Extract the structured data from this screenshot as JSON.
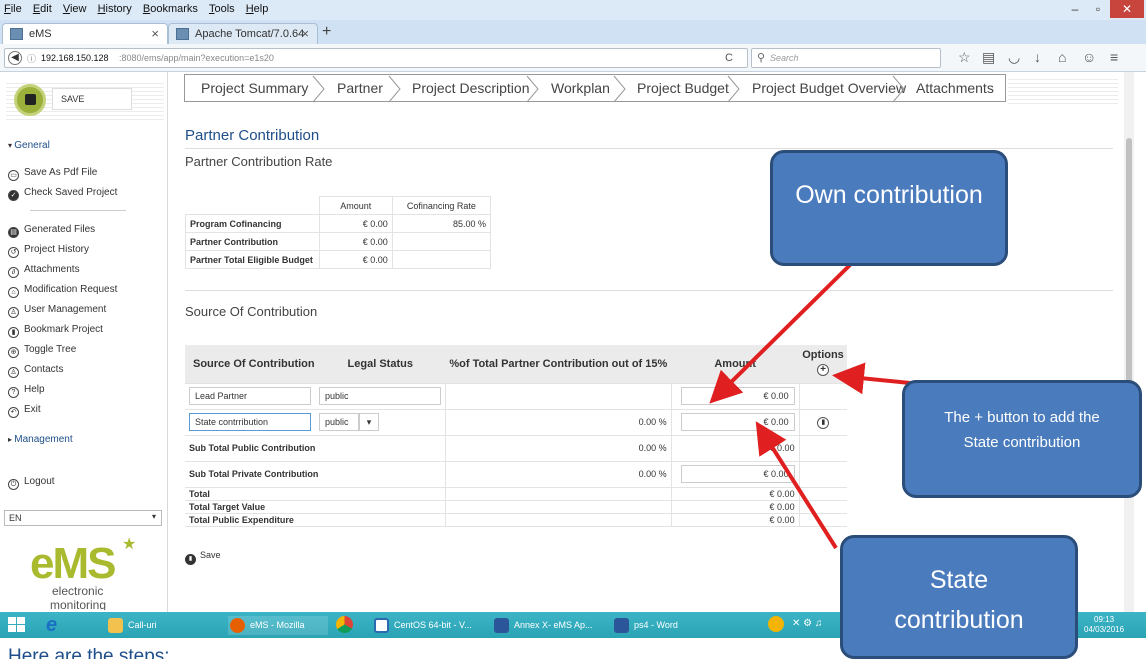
{
  "browser": {
    "menu": [
      "File",
      "Edit",
      "View",
      "History",
      "Bookmarks",
      "Tools",
      "Help"
    ],
    "tabs": [
      {
        "title": "eMS"
      },
      {
        "title": "Apache Tomcat/7.0.64"
      }
    ],
    "new_tab": "+",
    "url_host": "192.168.150.128",
    "url_rest": ":8080/ems/app/main?execution=e1s20",
    "reload": "C",
    "search_placeholder": "Search"
  },
  "app": {
    "save_label": "SAVE",
    "sidebar": {
      "general": "General",
      "items": [
        "Save As Pdf File",
        "Check Saved Project",
        "Generated Files",
        "Project History",
        "Attachments",
        "Modification Request",
        "User Management",
        "Bookmark Project",
        "Toggle Tree",
        "Contacts",
        "Help",
        "Exit"
      ],
      "management": "Management",
      "logout": "Logout",
      "language": "EN",
      "logo_text": "eMS",
      "logo_sub1": "electronic",
      "logo_sub2": "monitoring"
    },
    "wizard_tabs": [
      "Project Summary",
      "Partner",
      "Project Description",
      "Workplan",
      "Project Budget",
      "Project Budget Overview",
      "Attachments"
    ],
    "page_title": "Partner Contribution",
    "rate_title": "Partner Contribution Rate",
    "rate_table": {
      "headers": [
        "Amount",
        "Cofinancing Rate"
      ],
      "rows": [
        {
          "label": "Program Cofinancing",
          "amount": "€ 0.00",
          "rate": "85.00 %"
        },
        {
          "label": "Partner Contribution",
          "amount": "€ 0.00",
          "rate": ""
        },
        {
          "label": "Partner Total Eligible Budget",
          "amount": "€ 0.00",
          "rate": ""
        }
      ]
    },
    "source_title": "Source Of Contribution",
    "source_table": {
      "headers": [
        "Source Of Contribution",
        "Legal Status",
        "%of Total Partner Contribution out of 15%",
        "Amount",
        "Options"
      ],
      "lead_partner": {
        "source": "Lead Partner",
        "legal": "public",
        "amount": "€ 0.00"
      },
      "state": {
        "source": "State contrribution",
        "legal": "public",
        "pct": "0.00 %",
        "amount": "€ 0.00"
      },
      "subtotal_public": {
        "label": "Sub Total Public Contribution",
        "pct": "0.00 %",
        "amount": "€ 0.00"
      },
      "subtotal_private": {
        "label": "Sub Total Private Contribution",
        "pct": "0.00 %",
        "amount": "€ 0.00"
      },
      "total": {
        "label": "Total",
        "amount": "€ 0.00"
      },
      "target": {
        "label": "Total Target Value",
        "amount": "€ 0.00"
      },
      "public_exp": {
        "label": "Total Public Expenditure",
        "amount": "€ 0.00"
      }
    },
    "save_button": "Save"
  },
  "taskbar": {
    "items": [
      "Call-uri",
      "eMS - Mozilla Fire...",
      "CentOS 64-bit - V...",
      "Annex X- eMS Ap...",
      "ps4 - Word"
    ],
    "time": "09:13",
    "date": "04/03/2016"
  },
  "annotations": {
    "own": "Own contribution",
    "plus": "The + button to  add the  State contribution",
    "state": "State contribution"
  },
  "footer_text": "Here are the steps:"
}
